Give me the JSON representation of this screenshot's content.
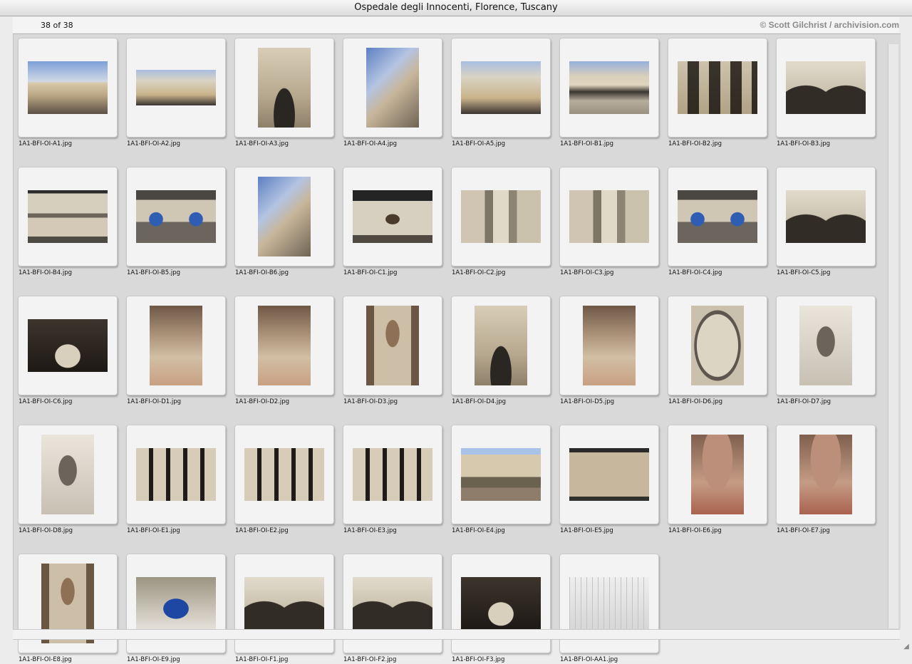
{
  "window": {
    "title": "Ospedale degli Innocenti, Florence, Tuscany"
  },
  "header": {
    "count": "38 of 38",
    "credit": "© Scott Gilchrist / archivision.com"
  },
  "items": [
    {
      "file": "1A1-BFI-OI-A1.jpg",
      "orientation": "land",
      "tone": "p-sky"
    },
    {
      "file": "1A1-BFI-OI-A2.jpg",
      "orientation": "wide",
      "tone": "p-sky2"
    },
    {
      "file": "1A1-BFI-OI-A3.jpg",
      "orientation": "port",
      "tone": "p-arch"
    },
    {
      "file": "1A1-BFI-OI-A4.jpg",
      "orientation": "port",
      "tone": "p-street"
    },
    {
      "file": "1A1-BFI-OI-A5.jpg",
      "orientation": "land",
      "tone": "p-sky2"
    },
    {
      "file": "1A1-BFI-OI-B1.jpg",
      "orientation": "land",
      "tone": "p-loggia"
    },
    {
      "file": "1A1-BFI-OI-B2.jpg",
      "orientation": "land",
      "tone": "p-arches"
    },
    {
      "file": "1A1-BFI-OI-B3.jpg",
      "orientation": "land",
      "tone": "p-arcade"
    },
    {
      "file": "1A1-BFI-OI-B4.jpg",
      "orientation": "land",
      "tone": "p-facade"
    },
    {
      "file": "1A1-BFI-OI-B5.jpg",
      "orientation": "land",
      "tone": "p-medal"
    },
    {
      "file": "1A1-BFI-OI-B6.jpg",
      "orientation": "port",
      "tone": "p-street"
    },
    {
      "file": "1A1-BFI-OI-C1.jpg",
      "orientation": "land",
      "tone": "p-window"
    },
    {
      "file": "1A1-BFI-OI-C2.jpg",
      "orientation": "land",
      "tone": "p-column"
    },
    {
      "file": "1A1-BFI-OI-C3.jpg",
      "orientation": "land",
      "tone": "p-column"
    },
    {
      "file": "1A1-BFI-OI-C4.jpg",
      "orientation": "land",
      "tone": "p-medal"
    },
    {
      "file": "1A1-BFI-OI-C5.jpg",
      "orientation": "land",
      "tone": "p-arcade"
    },
    {
      "file": "1A1-BFI-OI-C6.jpg",
      "orientation": "land",
      "tone": "p-dark"
    },
    {
      "file": "1A1-BFI-OI-D1.jpg",
      "orientation": "port",
      "tone": "p-portico"
    },
    {
      "file": "1A1-BFI-OI-D2.jpg",
      "orientation": "port",
      "tone": "p-portico"
    },
    {
      "file": "1A1-BFI-OI-D3.jpg",
      "orientation": "port",
      "tone": "p-door"
    },
    {
      "file": "1A1-BFI-OI-D4.jpg",
      "orientation": "port",
      "tone": "p-arch"
    },
    {
      "file": "1A1-BFI-OI-D5.jpg",
      "orientation": "port",
      "tone": "p-portico"
    },
    {
      "file": "1A1-BFI-OI-D6.jpg",
      "orientation": "port",
      "tone": "p-vault"
    },
    {
      "file": "1A1-BFI-OI-D7.jpg",
      "orientation": "port",
      "tone": "p-capital"
    },
    {
      "file": "1A1-BFI-OI-D8.jpg",
      "orientation": "port",
      "tone": "p-capital"
    },
    {
      "file": "1A1-BFI-OI-E1.jpg",
      "orientation": "land",
      "tone": "p-court"
    },
    {
      "file": "1A1-BFI-OI-E2.jpg",
      "orientation": "land",
      "tone": "p-court"
    },
    {
      "file": "1A1-BFI-OI-E3.jpg",
      "orientation": "land",
      "tone": "p-court"
    },
    {
      "file": "1A1-BFI-OI-E4.jpg",
      "orientation": "land",
      "tone": "p-courtyard"
    },
    {
      "file": "1A1-BFI-OI-E5.jpg",
      "orientation": "land",
      "tone": "p-sgraff"
    },
    {
      "file": "1A1-BFI-OI-E6.jpg",
      "orientation": "port",
      "tone": "p-pink"
    },
    {
      "file": "1A1-BFI-OI-E7.jpg",
      "orientation": "port",
      "tone": "p-pink"
    },
    {
      "file": "1A1-BFI-OI-E8.jpg",
      "orientation": "port",
      "tone": "p-door"
    },
    {
      "file": "1A1-BFI-OI-E9.jpg",
      "orientation": "land",
      "tone": "p-lunette"
    },
    {
      "file": "1A1-BFI-OI-F1.jpg",
      "orientation": "land",
      "tone": "p-arcade"
    },
    {
      "file": "1A1-BFI-OI-F2.jpg",
      "orientation": "land",
      "tone": "p-arcade"
    },
    {
      "file": "1A1-BFI-OI-F3.jpg",
      "orientation": "land",
      "tone": "p-dark"
    },
    {
      "file": "1A1-BFI-OI-AA1.jpg",
      "orientation": "land",
      "tone": "p-plan"
    }
  ]
}
